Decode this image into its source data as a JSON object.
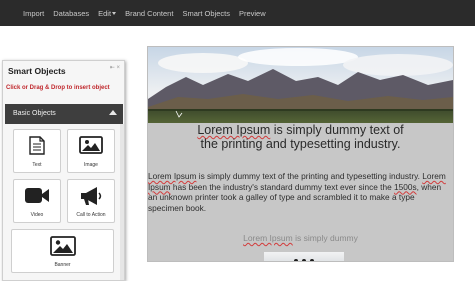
{
  "menu": [
    "Import",
    "Databases",
    "Edit",
    "Brand Content",
    "Smart Objects",
    "Preview"
  ],
  "panel": {
    "title": "Smart Objects",
    "controls": "⇤ ×",
    "hint": "Click or Drag & Drop to insert object",
    "section": "Basic Objects",
    "items": [
      "Text",
      "Image",
      "Video",
      "Call to Action",
      "Banner"
    ]
  },
  "canvas": {
    "headline": {
      "w1": "Lorem Ipsum",
      "rest": " is simply dummy text of",
      "line2": "the printing and typesetting industry."
    },
    "para": {
      "w1": "Lorem Ipsum",
      "t1": " is simply dummy text of the printing and typesetting industry. ",
      "w2": "Lorem Ipsum",
      "t2": " has been the industry's standard dummy text ever since the ",
      "w3": "1500s",
      "t3": ", when an unknown printer took a galley of type and scrambled it to make a type specimen book."
    },
    "sub": {
      "w1": "Lorem Ipsum",
      "rest": " is simply dummy"
    }
  }
}
